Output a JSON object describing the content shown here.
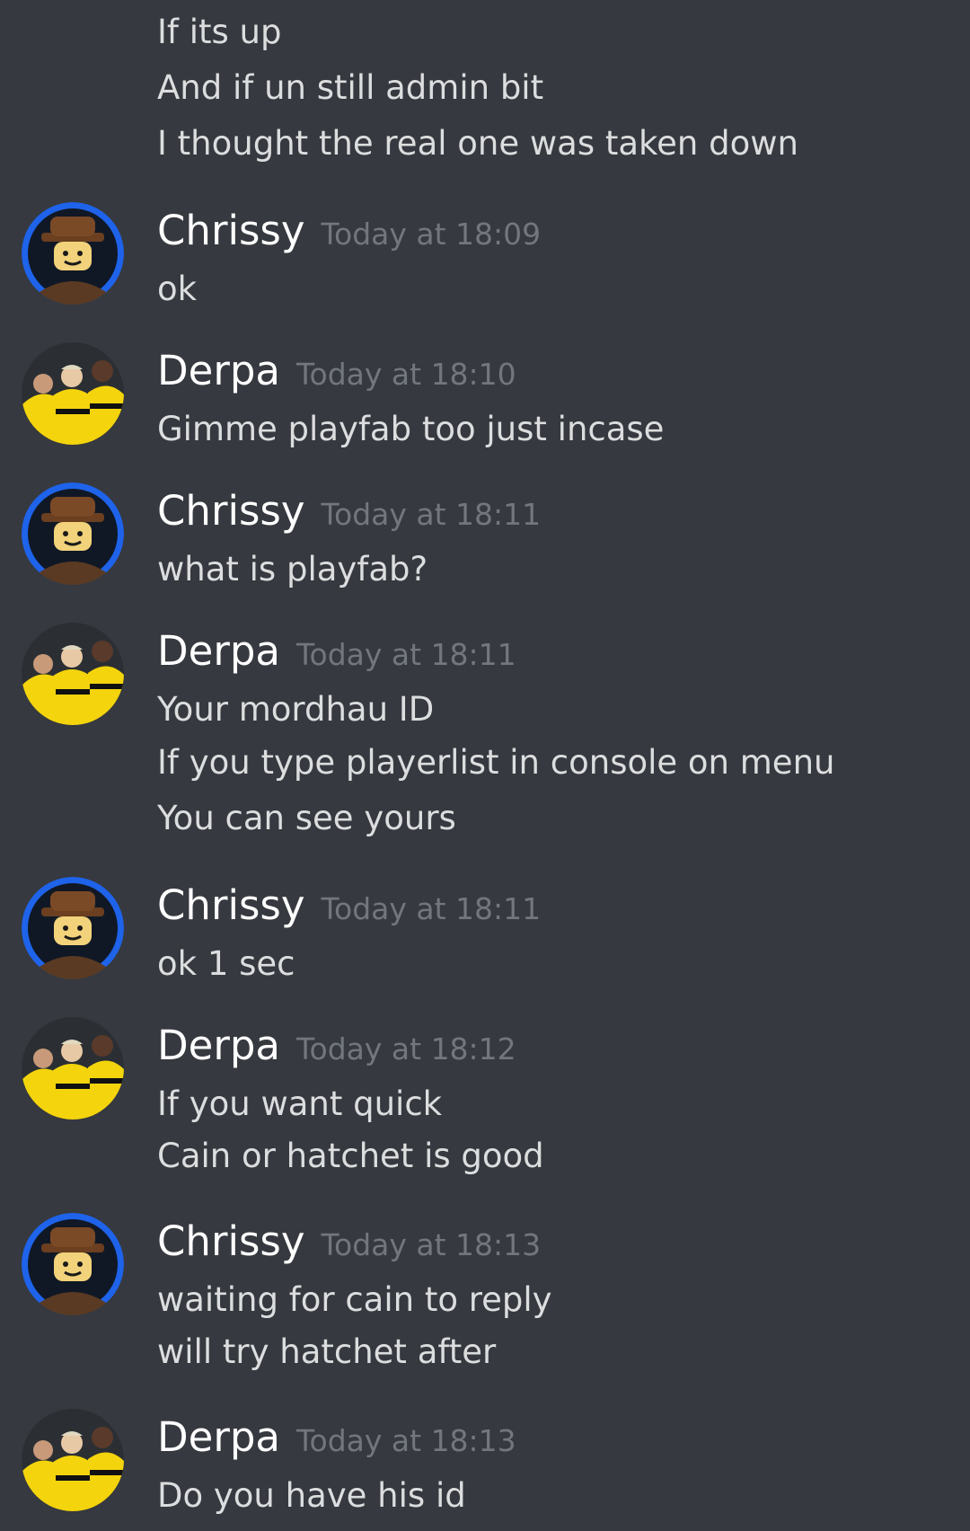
{
  "colors": {
    "background": "#36393f",
    "username": "#ffffff",
    "timestamp": "#72767d",
    "message": "#dcddde",
    "chrissy_ring": "#1e63e9",
    "derpa_jersey": "#f4d40c"
  },
  "continuation": {
    "lines": [
      "If its up",
      "And if un still admin bit",
      "I thought the real one was taken down"
    ]
  },
  "messages": [
    {
      "author": "Chrissy",
      "avatar": "lego-figure-avatar",
      "time": "Today at 18:09",
      "lines": [
        "ok"
      ]
    },
    {
      "author": "Derpa",
      "avatar": "football-players-avatar",
      "time": "Today at 18:10",
      "lines": [
        "Gimme playfab too just incase"
      ]
    },
    {
      "author": "Chrissy",
      "avatar": "lego-figure-avatar",
      "time": "Today at 18:11",
      "lines": [
        "what is playfab?"
      ]
    },
    {
      "author": "Derpa",
      "avatar": "football-players-avatar",
      "time": "Today at 18:11",
      "lines": [
        "Your mordhau ID",
        "If you type playerlist in console on menu",
        "You can see yours"
      ]
    },
    {
      "author": "Chrissy",
      "avatar": "lego-figure-avatar",
      "time": "Today at 18:11",
      "lines": [
        "ok 1 sec"
      ]
    },
    {
      "author": "Derpa",
      "avatar": "football-players-avatar",
      "time": "Today at 18:12",
      "lines": [
        "If you want quick",
        "Cain or hatchet is good"
      ]
    },
    {
      "author": "Chrissy",
      "avatar": "lego-figure-avatar",
      "time": "Today at 18:13",
      "lines": [
        "waiting for cain to reply",
        "will try hatchet after"
      ]
    },
    {
      "author": "Derpa",
      "avatar": "football-players-avatar",
      "time": "Today at 18:13",
      "lines": [
        "Do you have his id"
      ]
    }
  ]
}
